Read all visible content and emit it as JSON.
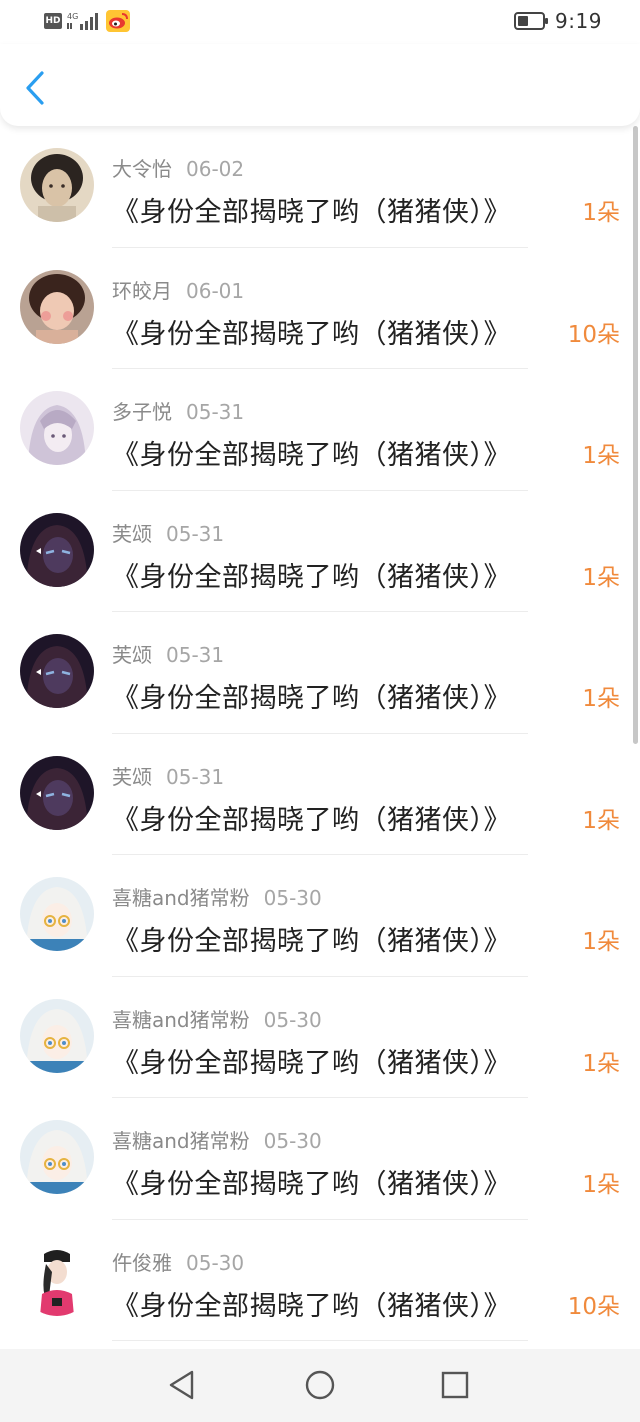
{
  "status_bar": {
    "network_badge": "HD",
    "signal_label": "4G",
    "time": "9:19",
    "icons": [
      "hd-icon",
      "signal-icon",
      "weibo-icon",
      "battery-icon"
    ]
  },
  "header": {
    "back_icon": "chevron-left-icon",
    "accent_color": "#2a9ef0"
  },
  "records": [
    {
      "name": "大令怡",
      "date": "06-02",
      "title": "《身份全部揭晓了哟（猪猪侠）》",
      "count": "1朵"
    },
    {
      "name": "环皎月",
      "date": "06-01",
      "title": "《身份全部揭晓了哟（猪猪侠）》",
      "count": "10朵"
    },
    {
      "name": "多子悦",
      "date": "05-31",
      "title": "《身份全部揭晓了哟（猪猪侠）》",
      "count": "1朵"
    },
    {
      "name": "芙颂",
      "date": "05-31",
      "title": "《身份全部揭晓了哟（猪猪侠）》",
      "count": "1朵"
    },
    {
      "name": "芙颂",
      "date": "05-31",
      "title": "《身份全部揭晓了哟（猪猪侠）》",
      "count": "1朵"
    },
    {
      "name": "芙颂",
      "date": "05-31",
      "title": "《身份全部揭晓了哟（猪猪侠）》",
      "count": "1朵"
    },
    {
      "name": "喜糖and猪常粉",
      "date": "05-30",
      "title": "《身份全部揭晓了哟（猪猪侠）》",
      "count": "1朵"
    },
    {
      "name": "喜糖and猪常粉",
      "date": "05-30",
      "title": "《身份全部揭晓了哟（猪猪侠）》",
      "count": "1朵"
    },
    {
      "name": "喜糖and猪常粉",
      "date": "05-30",
      "title": "《身份全部揭晓了哟（猪猪侠）》",
      "count": "1朵"
    },
    {
      "name": "仵俊雅",
      "date": "05-30",
      "title": "《身份全部揭晓了哟（猪猪侠）》",
      "count": "10朵"
    }
  ],
  "nav_bar": {
    "icons": [
      "back-triangle-icon",
      "home-circle-icon",
      "recents-square-icon"
    ]
  },
  "colors": {
    "count": "#f08a3c",
    "name": "#8a8a8a",
    "date": "#a6a6a6",
    "title": "#222222"
  }
}
